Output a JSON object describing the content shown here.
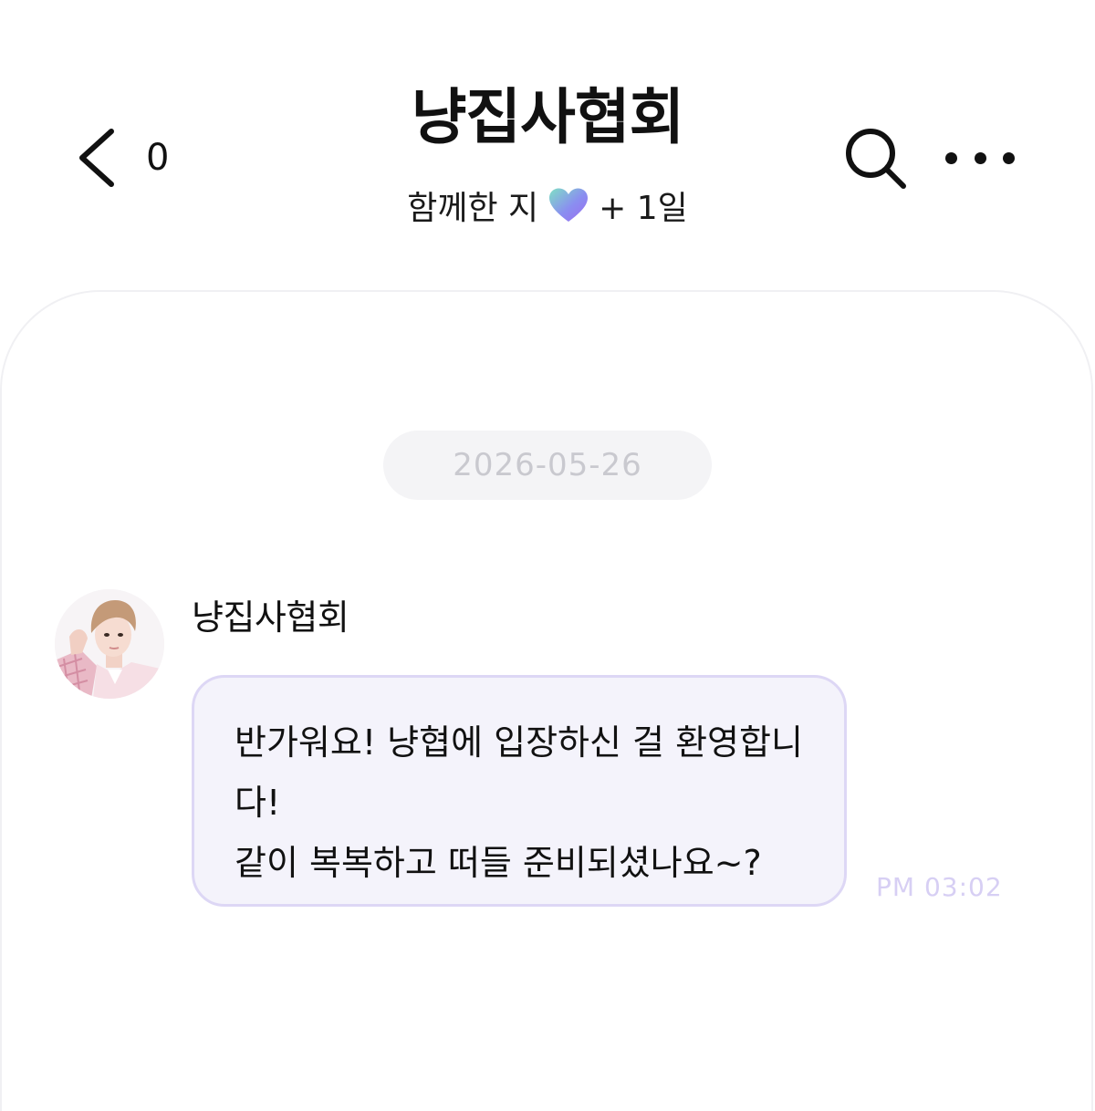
{
  "header": {
    "unread_count": "0",
    "title": "냥집사협회",
    "subtitle_prefix": "함께한 지",
    "subtitle_suffix": "+ 1일"
  },
  "chat": {
    "date": "2026-05-26",
    "messages": [
      {
        "sender": "냥집사협회",
        "text": "반가워요! 냥협에 입장하신 걸 환영합니\n다!\n같이 복복하고 떠들 준비되셨나요~?",
        "time": "PM 03:02"
      }
    ]
  },
  "colors": {
    "bubble_bg": "#f4f3fb",
    "bubble_border": "#ddd7f5",
    "timestamp": "#d7cff4",
    "date_pill_bg": "#f4f4f6",
    "date_text": "#c9c9cf"
  },
  "icons": {
    "back": "chevron-left-icon",
    "heart": "gradient-heart-icon",
    "search": "search-icon",
    "more": "more-dots-icon"
  }
}
